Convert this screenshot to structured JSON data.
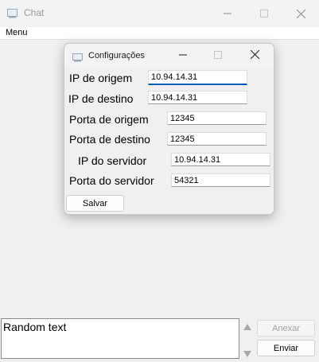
{
  "window": {
    "title": "Chat",
    "icon": "chat-window-icon",
    "controls": [
      "minimize-icon",
      "maximize-icon",
      "close-icon"
    ]
  },
  "menubar": {
    "items": [
      {
        "label": "Menu"
      }
    ]
  },
  "dialog": {
    "title": "Configurações",
    "icon": "settings-window-icon",
    "fields": [
      {
        "label": "IP de origem",
        "value": "10.94.14.31"
      },
      {
        "label": "IP de destino",
        "value": "10.94.14.31"
      },
      {
        "label": "Porta de origem",
        "value": "12345"
      },
      {
        "label": "Porta de destino",
        "value": "12345"
      },
      {
        "label": "IP do servidor",
        "value": "10.94.14.31"
      },
      {
        "label": "Porta do servidor",
        "value": "54321"
      }
    ],
    "save_label": "Salvar"
  },
  "composer": {
    "message_text": "Random text",
    "attach_label": "Anexar",
    "send_label": "Enviar"
  },
  "colors": {
    "accent": "#005fb8",
    "background": "#f0f0f0",
    "disabled_text": "#a0a0a0"
  }
}
